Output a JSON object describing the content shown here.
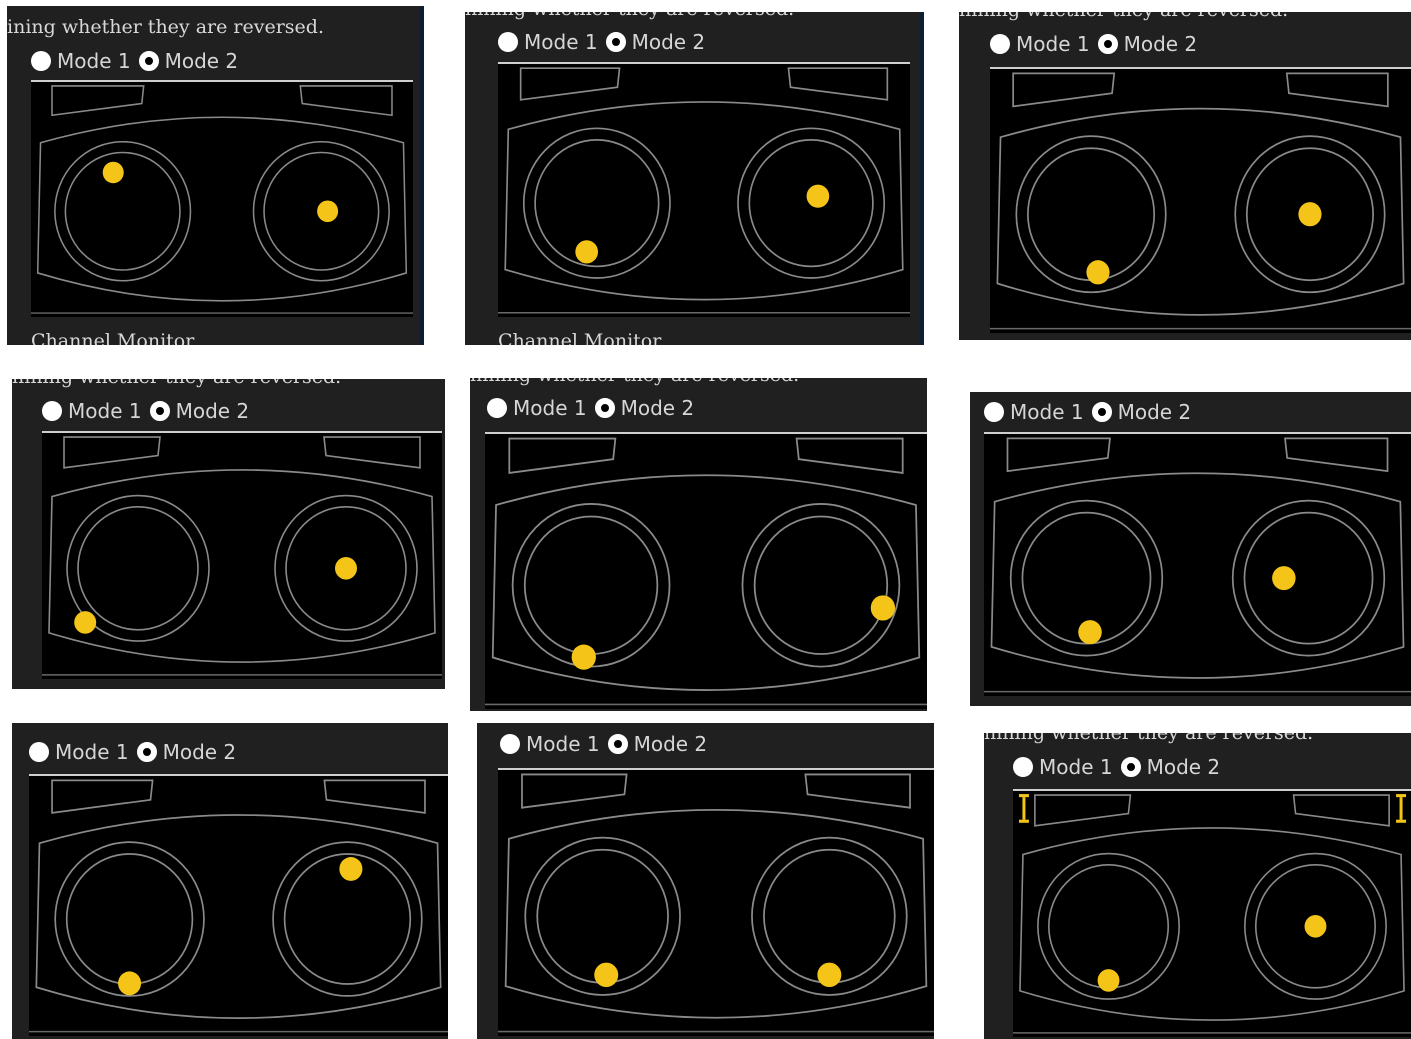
{
  "instruction_text": "ining whether they are reversed.",
  "instruction_text_clipped": "hining whether they are reversed.",
  "radio_group": {
    "mode1_label": "Mode 1",
    "mode2_label": "Mode 2",
    "selected": "Mode 2"
  },
  "footer_label": "Channel Monitor",
  "colors": {
    "panel_bg": "#202020",
    "screen_bg": "#000000",
    "outline": "#8a8a8a",
    "stick_dot": "#f4c518",
    "trim_marker": "#f4c518"
  },
  "icons": {
    "radio_unselected": "radio-empty-icon",
    "radio_selected": "radio-filled-icon",
    "stick_position": "yellow-dot-icon",
    "trim_marker": "i-beam-icon"
  },
  "stick_positions_note_units": "normalized stick deflection, -1..1 (x right, y up)",
  "panels": [
    {
      "id": "p1",
      "left_stick": [
        -0.15,
        0.6
      ],
      "right_stick": [
        0.1,
        0.0
      ]
    },
    {
      "id": "p2",
      "left_stick": [
        -0.15,
        -0.7
      ],
      "right_stick": [
        0.1,
        0.1
      ]
    },
    {
      "id": "p3",
      "left_stick": [
        0.1,
        -0.8
      ],
      "right_stick": [
        0.0,
        0.0
      ]
    },
    {
      "id": "p4",
      "left_stick": [
        -0.8,
        -0.8
      ],
      "right_stick": [
        0.0,
        0.0
      ]
    },
    {
      "id": "p5",
      "left_stick": [
        -0.1,
        -0.95
      ],
      "right_stick": [
        0.85,
        -0.3
      ]
    },
    {
      "id": "p6",
      "left_stick": [
        0.05,
        -0.75
      ],
      "right_stick": [
        -0.35,
        0.0
      ]
    },
    {
      "id": "p7",
      "left_stick": [
        0.0,
        -0.9
      ],
      "right_stick": [
        0.05,
        0.7
      ]
    },
    {
      "id": "p8",
      "left_stick": [
        0.05,
        -0.8
      ],
      "right_stick": [
        0.0,
        -0.8
      ]
    },
    {
      "id": "p9",
      "left_stick": [
        0.0,
        -0.8
      ],
      "right_stick": [
        0.0,
        0.0
      ],
      "trim_markers": true
    }
  ]
}
